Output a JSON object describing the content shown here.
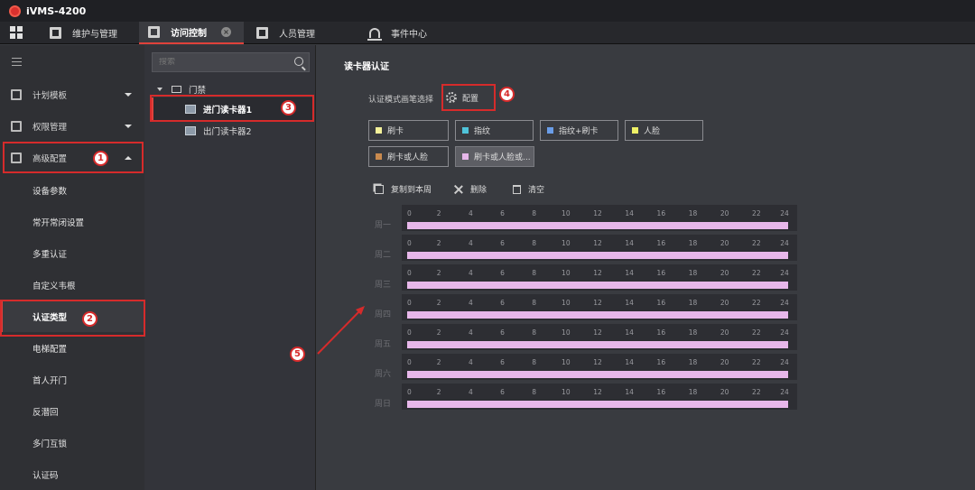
{
  "app": {
    "title": "iVMS-4200"
  },
  "tabs": [
    {
      "label": "维护与管理"
    },
    {
      "label": "访问控制"
    },
    {
      "label": "人员管理"
    },
    {
      "label": "事件中心"
    }
  ],
  "sidebar": {
    "groups": [
      {
        "label": "计划模板"
      },
      {
        "label": "权限管理"
      },
      {
        "label": "高级配置"
      }
    ],
    "subitems": [
      {
        "label": "设备参数"
      },
      {
        "label": "常开常闭设置"
      },
      {
        "label": "多重认证"
      },
      {
        "label": "自定义韦根"
      },
      {
        "label": "认证类型"
      },
      {
        "label": "电梯配置"
      },
      {
        "label": "首人开门"
      },
      {
        "label": "反潜回"
      },
      {
        "label": "多门互锁"
      },
      {
        "label": "认证码"
      }
    ]
  },
  "tree": {
    "search_placeholder": "搜索",
    "root": "门禁",
    "nodes": [
      {
        "label": "进门读卡器1"
      },
      {
        "label": "出门读卡器2"
      }
    ]
  },
  "main": {
    "title": "读卡器认证",
    "mode_label": "认证模式画笔选择",
    "config_label": "配置",
    "modes": [
      {
        "label": "刷卡",
        "color": "#f4f29a"
      },
      {
        "label": "指纹",
        "color": "#4fc3d9"
      },
      {
        "label": "指纹+刷卡",
        "color": "#6a9de8"
      },
      {
        "label": "人脸",
        "color": "#eef066"
      },
      {
        "label": "刷卡或人脸",
        "color": "#c98a4e"
      },
      {
        "label": "刷卡或人脸或...",
        "color": "#e7b7ea"
      }
    ],
    "tools": {
      "copy": "复制到本周",
      "delete": "删除",
      "clear": "清空"
    },
    "schedule": {
      "ticks": [
        "0",
        "2",
        "4",
        "6",
        "8",
        "10",
        "12",
        "14",
        "16",
        "18",
        "20",
        "22",
        "24"
      ],
      "days": [
        "周一",
        "周二",
        "周三",
        "周四",
        "周五",
        "周六",
        "周日"
      ],
      "bar_color": "#e7b7ea"
    }
  },
  "annotations": {
    "badges": [
      "1",
      "2",
      "3",
      "4",
      "5"
    ],
    "accent": "#d62b2b"
  }
}
